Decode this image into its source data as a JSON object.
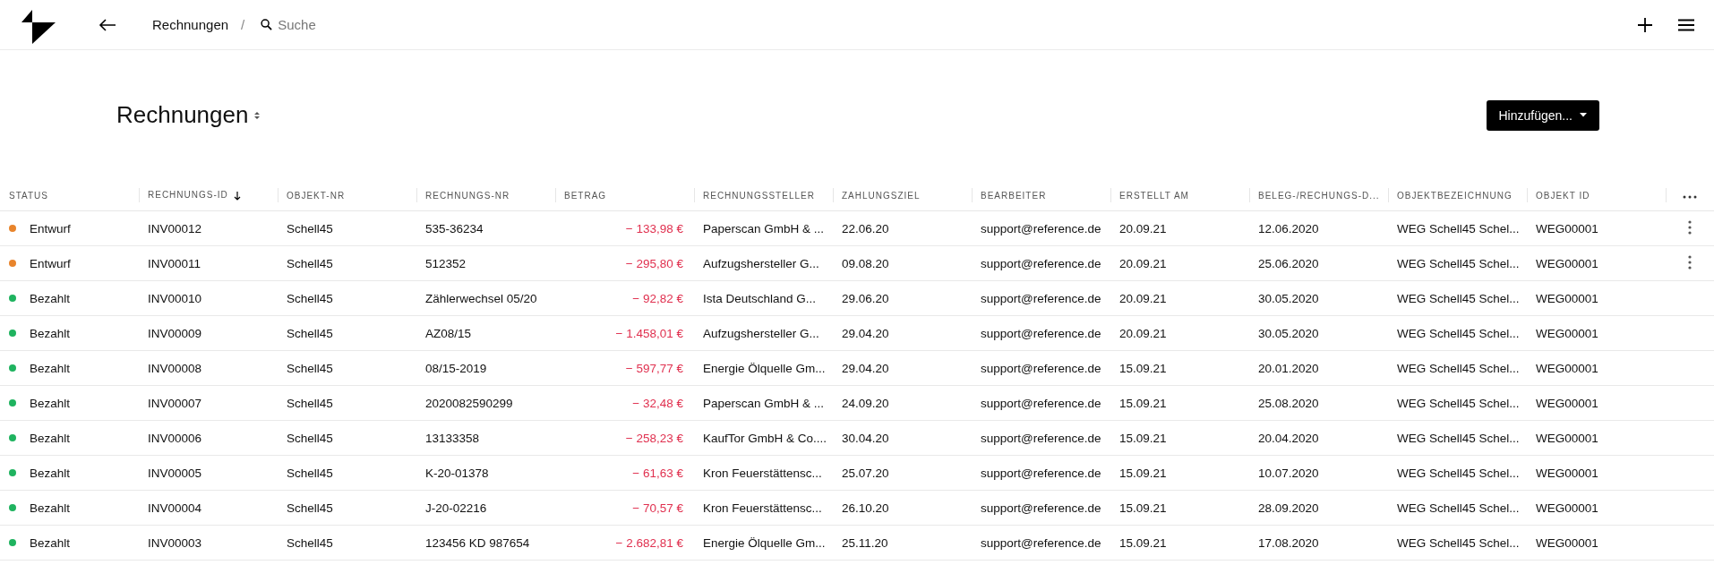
{
  "top_bar": {
    "breadcrumb": "Rechnungen",
    "separator": "/",
    "search": {
      "placeholder": "Suche"
    }
  },
  "page": {
    "title": "Rechnungen",
    "add_button": "Hinzufügen..."
  },
  "table": {
    "columns": [
      {
        "label": "STATUS",
        "sorted": false
      },
      {
        "label": "RECHNUNGS-ID",
        "sorted": true
      },
      {
        "label": "OBJEKT-NR",
        "sorted": false
      },
      {
        "label": "RECHNUNGS-NR",
        "sorted": false
      },
      {
        "label": "BETRAG",
        "sorted": false
      },
      {
        "label": "RECHNUNGSSTELLER",
        "sorted": false
      },
      {
        "label": "ZAHLUNGSZIEL",
        "sorted": false
      },
      {
        "label": "BEARBEITER",
        "sorted": false
      },
      {
        "label": "ERSTELLT AM",
        "sorted": false
      },
      {
        "label": "BELEG-/RECHUNGS-D...",
        "sorted": false
      },
      {
        "label": "OBJEKTBEZEICHNUNG",
        "sorted": false
      },
      {
        "label": "OBJEKT ID",
        "sorted": false
      }
    ],
    "rows": [
      {
        "color": "#e8842c",
        "has_menu": true,
        "cells": [
          "Entwurf",
          "INV00012",
          "Schell45",
          "535-36234",
          "− 133,98 €",
          "Paperscan GmbH & ...",
          "22.06.20",
          "support@reference.de",
          "20.09.21",
          "12.06.2020",
          "WEG Schell45 Schel...",
          "WEG00001"
        ]
      },
      {
        "color": "#e8842c",
        "has_menu": true,
        "cells": [
          "Entwurf",
          "INV00011",
          "Schell45",
          "512352",
          "− 295,80 €",
          "Aufzugshersteller G...",
          "09.08.20",
          "support@reference.de",
          "20.09.21",
          "25.06.2020",
          "WEG Schell45 Schel...",
          "WEG00001"
        ]
      },
      {
        "color": "#1fb35f",
        "has_menu": false,
        "cells": [
          "Bezahlt",
          "INV00010",
          "Schell45",
          "Zählerwechsel 05/20",
          "− 92,82 €",
          "Ista Deutschland G...",
          "29.06.20",
          "support@reference.de",
          "20.09.21",
          "30.05.2020",
          "WEG Schell45 Schel...",
          "WEG00001"
        ]
      },
      {
        "color": "#1fb35f",
        "has_menu": false,
        "cells": [
          "Bezahlt",
          "INV00009",
          "Schell45",
          "AZ08/15",
          "− 1.458,01 €",
          "Aufzugshersteller G...",
          "29.04.20",
          "support@reference.de",
          "20.09.21",
          "30.05.2020",
          "WEG Schell45 Schel...",
          "WEG00001"
        ]
      },
      {
        "color": "#1fb35f",
        "has_menu": false,
        "cells": [
          "Bezahlt",
          "INV00008",
          "Schell45",
          "08/15-2019",
          "− 597,77 €",
          "Energie Ölquelle Gm...",
          "29.04.20",
          "support@reference.de",
          "15.09.21",
          "20.01.2020",
          "WEG Schell45 Schel...",
          "WEG00001"
        ]
      },
      {
        "color": "#1fb35f",
        "has_menu": false,
        "cells": [
          "Bezahlt",
          "INV00007",
          "Schell45",
          "2020082590299",
          "− 32,48 €",
          "Paperscan GmbH & ...",
          "24.09.20",
          "support@reference.de",
          "15.09.21",
          "25.08.2020",
          "WEG Schell45 Schel...",
          "WEG00001"
        ]
      },
      {
        "color": "#1fb35f",
        "has_menu": false,
        "cells": [
          "Bezahlt",
          "INV00006",
          "Schell45",
          "13133358",
          "− 258,23 €",
          "KaufTor GmbH & Co....",
          "30.04.20",
          "support@reference.de",
          "15.09.21",
          "20.04.2020",
          "WEG Schell45 Schel...",
          "WEG00001"
        ]
      },
      {
        "color": "#1fb35f",
        "has_menu": false,
        "cells": [
          "Bezahlt",
          "INV00005",
          "Schell45",
          "K-20-01378",
          "− 61,63 €",
          "Kron Feuerstättensc...",
          "25.07.20",
          "support@reference.de",
          "15.09.21",
          "10.07.2020",
          "WEG Schell45 Schel...",
          "WEG00001"
        ]
      },
      {
        "color": "#1fb35f",
        "has_menu": false,
        "cells": [
          "Bezahlt",
          "INV00004",
          "Schell45",
          "J-20-02216",
          "− 70,57 €",
          "Kron Feuerstättensc...",
          "26.10.20",
          "support@reference.de",
          "15.09.21",
          "28.09.2020",
          "WEG Schell45 Schel...",
          "WEG00001"
        ]
      },
      {
        "color": "#1fb35f",
        "has_menu": false,
        "cells": [
          "Bezahlt",
          "INV00003",
          "Schell45",
          "123456 KD 987654",
          "− 2.682,81 €",
          "Energie Ölquelle Gm...",
          "25.11.20",
          "support@reference.de",
          "15.09.21",
          "17.08.2020",
          "WEG Schell45 Schel...",
          "WEG00001"
        ]
      }
    ]
  }
}
